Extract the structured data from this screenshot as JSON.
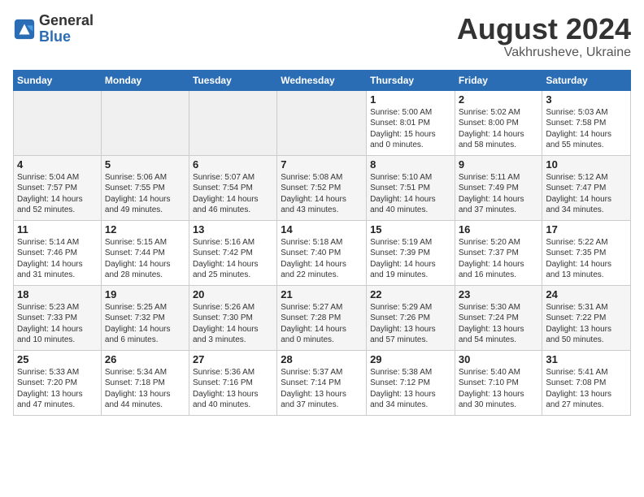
{
  "logo": {
    "general": "General",
    "blue": "Blue"
  },
  "header": {
    "month_year": "August 2024",
    "location": "Vakhrusheve, Ukraine"
  },
  "days_of_week": [
    "Sunday",
    "Monday",
    "Tuesday",
    "Wednesday",
    "Thursday",
    "Friday",
    "Saturday"
  ],
  "weeks": [
    [
      {
        "day": "",
        "info": ""
      },
      {
        "day": "",
        "info": ""
      },
      {
        "day": "",
        "info": ""
      },
      {
        "day": "",
        "info": ""
      },
      {
        "day": "1",
        "info": "Sunrise: 5:00 AM\nSunset: 8:01 PM\nDaylight: 15 hours\nand 0 minutes."
      },
      {
        "day": "2",
        "info": "Sunrise: 5:02 AM\nSunset: 8:00 PM\nDaylight: 14 hours\nand 58 minutes."
      },
      {
        "day": "3",
        "info": "Sunrise: 5:03 AM\nSunset: 7:58 PM\nDaylight: 14 hours\nand 55 minutes."
      }
    ],
    [
      {
        "day": "4",
        "info": "Sunrise: 5:04 AM\nSunset: 7:57 PM\nDaylight: 14 hours\nand 52 minutes."
      },
      {
        "day": "5",
        "info": "Sunrise: 5:06 AM\nSunset: 7:55 PM\nDaylight: 14 hours\nand 49 minutes."
      },
      {
        "day": "6",
        "info": "Sunrise: 5:07 AM\nSunset: 7:54 PM\nDaylight: 14 hours\nand 46 minutes."
      },
      {
        "day": "7",
        "info": "Sunrise: 5:08 AM\nSunset: 7:52 PM\nDaylight: 14 hours\nand 43 minutes."
      },
      {
        "day": "8",
        "info": "Sunrise: 5:10 AM\nSunset: 7:51 PM\nDaylight: 14 hours\nand 40 minutes."
      },
      {
        "day": "9",
        "info": "Sunrise: 5:11 AM\nSunset: 7:49 PM\nDaylight: 14 hours\nand 37 minutes."
      },
      {
        "day": "10",
        "info": "Sunrise: 5:12 AM\nSunset: 7:47 PM\nDaylight: 14 hours\nand 34 minutes."
      }
    ],
    [
      {
        "day": "11",
        "info": "Sunrise: 5:14 AM\nSunset: 7:46 PM\nDaylight: 14 hours\nand 31 minutes."
      },
      {
        "day": "12",
        "info": "Sunrise: 5:15 AM\nSunset: 7:44 PM\nDaylight: 14 hours\nand 28 minutes."
      },
      {
        "day": "13",
        "info": "Sunrise: 5:16 AM\nSunset: 7:42 PM\nDaylight: 14 hours\nand 25 minutes."
      },
      {
        "day": "14",
        "info": "Sunrise: 5:18 AM\nSunset: 7:40 PM\nDaylight: 14 hours\nand 22 minutes."
      },
      {
        "day": "15",
        "info": "Sunrise: 5:19 AM\nSunset: 7:39 PM\nDaylight: 14 hours\nand 19 minutes."
      },
      {
        "day": "16",
        "info": "Sunrise: 5:20 AM\nSunset: 7:37 PM\nDaylight: 14 hours\nand 16 minutes."
      },
      {
        "day": "17",
        "info": "Sunrise: 5:22 AM\nSunset: 7:35 PM\nDaylight: 14 hours\nand 13 minutes."
      }
    ],
    [
      {
        "day": "18",
        "info": "Sunrise: 5:23 AM\nSunset: 7:33 PM\nDaylight: 14 hours\nand 10 minutes."
      },
      {
        "day": "19",
        "info": "Sunrise: 5:25 AM\nSunset: 7:32 PM\nDaylight: 14 hours\nand 6 minutes."
      },
      {
        "day": "20",
        "info": "Sunrise: 5:26 AM\nSunset: 7:30 PM\nDaylight: 14 hours\nand 3 minutes."
      },
      {
        "day": "21",
        "info": "Sunrise: 5:27 AM\nSunset: 7:28 PM\nDaylight: 14 hours\nand 0 minutes."
      },
      {
        "day": "22",
        "info": "Sunrise: 5:29 AM\nSunset: 7:26 PM\nDaylight: 13 hours\nand 57 minutes."
      },
      {
        "day": "23",
        "info": "Sunrise: 5:30 AM\nSunset: 7:24 PM\nDaylight: 13 hours\nand 54 minutes."
      },
      {
        "day": "24",
        "info": "Sunrise: 5:31 AM\nSunset: 7:22 PM\nDaylight: 13 hours\nand 50 minutes."
      }
    ],
    [
      {
        "day": "25",
        "info": "Sunrise: 5:33 AM\nSunset: 7:20 PM\nDaylight: 13 hours\nand 47 minutes."
      },
      {
        "day": "26",
        "info": "Sunrise: 5:34 AM\nSunset: 7:18 PM\nDaylight: 13 hours\nand 44 minutes."
      },
      {
        "day": "27",
        "info": "Sunrise: 5:36 AM\nSunset: 7:16 PM\nDaylight: 13 hours\nand 40 minutes."
      },
      {
        "day": "28",
        "info": "Sunrise: 5:37 AM\nSunset: 7:14 PM\nDaylight: 13 hours\nand 37 minutes."
      },
      {
        "day": "29",
        "info": "Sunrise: 5:38 AM\nSunset: 7:12 PM\nDaylight: 13 hours\nand 34 minutes."
      },
      {
        "day": "30",
        "info": "Sunrise: 5:40 AM\nSunset: 7:10 PM\nDaylight: 13 hours\nand 30 minutes."
      },
      {
        "day": "31",
        "info": "Sunrise: 5:41 AM\nSunset: 7:08 PM\nDaylight: 13 hours\nand 27 minutes."
      }
    ]
  ]
}
